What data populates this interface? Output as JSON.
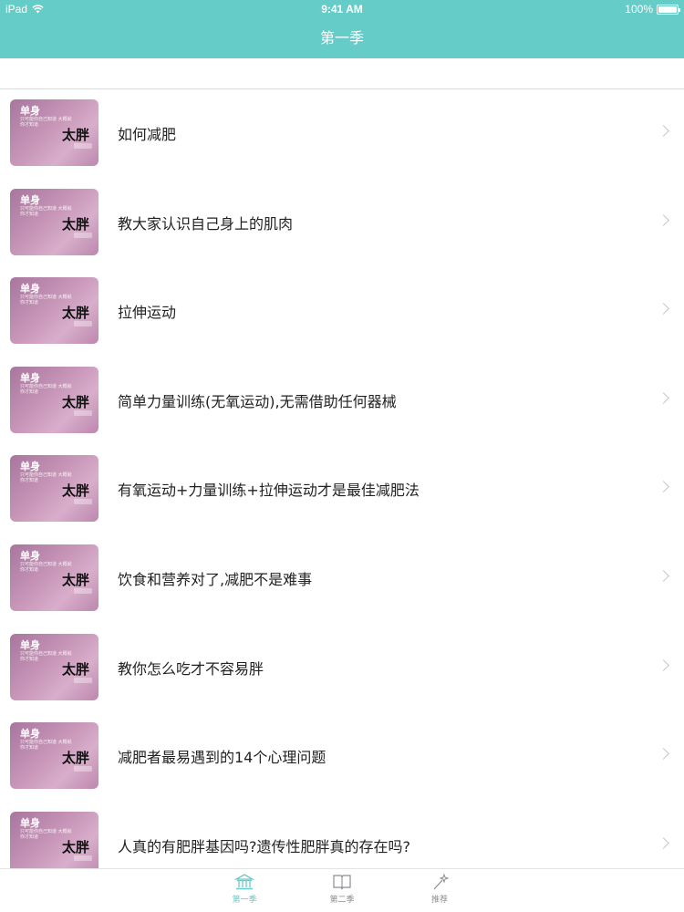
{
  "status_bar": {
    "device": "iPad",
    "time": "9:41 AM",
    "battery": "100%"
  },
  "nav": {
    "title": "第一季"
  },
  "thumbnail_text": {
    "line1": "单身",
    "line2": "只可能你自己知道\n大概就你才知道",
    "big": "太胖"
  },
  "items": [
    {
      "title": "如何减肥"
    },
    {
      "title": "教大家认识自己身上的肌肉"
    },
    {
      "title": "拉伸运动"
    },
    {
      "title": "简单力量训练(无氧运动),无需借助任何器械"
    },
    {
      "title": "有氧运动+力量训练+拉伸运动才是最佳减肥法"
    },
    {
      "title": "饮食和营养对了,减肥不是难事"
    },
    {
      "title": "教你怎么吃才不容易胖"
    },
    {
      "title": "减肥者最易遇到的14个心理问题"
    },
    {
      "title": "人真的有肥胖基因吗?遗传性肥胖真的存在吗?"
    }
  ],
  "tabs": [
    {
      "label": "第一季",
      "icon": "bank-icon",
      "active": true
    },
    {
      "label": "第二季",
      "icon": "book-icon",
      "active": false
    },
    {
      "label": "推荐",
      "icon": "magic-wand-icon",
      "active": false
    }
  ],
  "colors": {
    "accent": "#66ccc8",
    "thumbnail": "#c896b8"
  }
}
